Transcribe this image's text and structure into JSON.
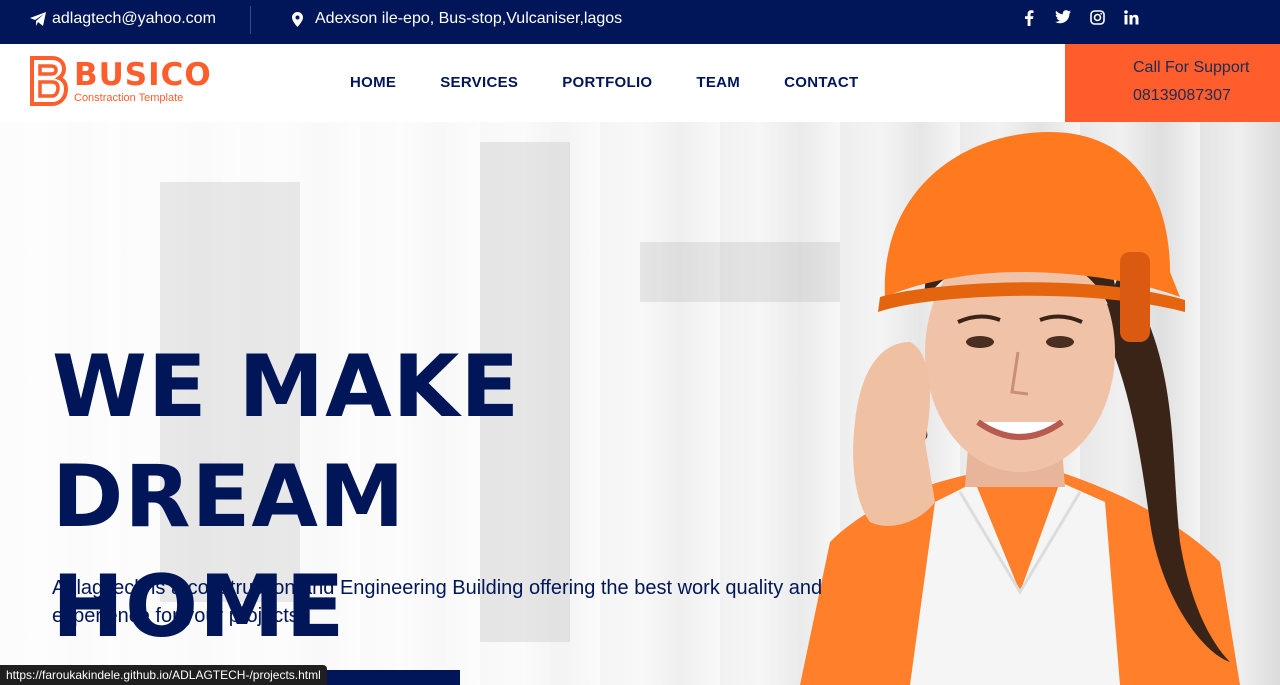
{
  "topbar": {
    "email": "adlagtech@yahoo.com",
    "address": "Adexson ile-epo, Bus-stop,Vulcaniser,lagos",
    "social": [
      "f",
      "twitter",
      "instagram",
      "in"
    ]
  },
  "brand": {
    "name": "BUSICO",
    "tagline": "Constraction Template",
    "color": "#ff5e2c"
  },
  "nav": {
    "items": [
      {
        "label": "HOME"
      },
      {
        "label": "SERVICES"
      },
      {
        "label": "PORTFOLIO"
      },
      {
        "label": "TEAM"
      },
      {
        "label": "CONTACT"
      }
    ]
  },
  "support": {
    "label": "Call For Support",
    "phone": "08139087307"
  },
  "hero": {
    "title_line1": "WE MAKE DREAM",
    "title_line2": "HOME",
    "description": "AdlagTech is a construction and Engineering Building offering the best work quality and experience for your projects."
  },
  "statusbar": {
    "url": "https://faroukakindele.github.io/ADLAGTECH-/projects.html"
  },
  "colors": {
    "navy": "#001659",
    "orange": "#ff5e2c"
  }
}
